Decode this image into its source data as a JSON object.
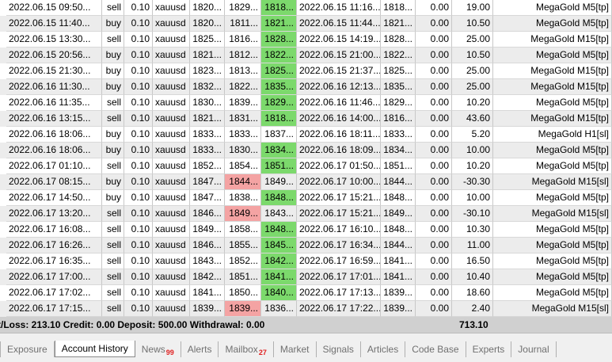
{
  "columns": [
    "open_time",
    "type",
    "volume",
    "symbol",
    "open_price",
    "sl",
    "tp",
    "close_time",
    "close_price",
    "commission",
    "profit",
    "comment"
  ],
  "rows": [
    {
      "open_time": "2022.06.15 09:50...",
      "type": "sell",
      "volume": "0.10",
      "symbol": "xauusd",
      "open_price": "1820...",
      "sl": "1829...",
      "tp": "1818...",
      "close_time": "2022.06.15 11:16...",
      "close_price": "1818...",
      "commission": "0.00",
      "profit": "19.00",
      "comment": "MegaGold M5[tp]",
      "hl": "tp"
    },
    {
      "open_time": "2022.06.15 11:40...",
      "type": "buy",
      "volume": "0.10",
      "symbol": "xauusd",
      "open_price": "1820...",
      "sl": "1811...",
      "tp": "1821...",
      "close_time": "2022.06.15 11:44...",
      "close_price": "1821...",
      "commission": "0.00",
      "profit": "10.50",
      "comment": "MegaGold M5[tp]",
      "hl": "tp"
    },
    {
      "open_time": "2022.06.15 13:30...",
      "type": "sell",
      "volume": "0.10",
      "symbol": "xauusd",
      "open_price": "1825...",
      "sl": "1816...",
      "tp": "1828...",
      "close_time": "2022.06.15 14:19...",
      "close_price": "1828...",
      "commission": "0.00",
      "profit": "25.00",
      "comment": "MegaGold M15[tp]",
      "hl": "tp"
    },
    {
      "open_time": "2022.06.15 20:56...",
      "type": "buy",
      "volume": "0.10",
      "symbol": "xauusd",
      "open_price": "1821...",
      "sl": "1812...",
      "tp": "1822...",
      "close_time": "2022.06.15 21:00...",
      "close_price": "1822...",
      "commission": "0.00",
      "profit": "10.50",
      "comment": "MegaGold M5[tp]",
      "hl": "tp"
    },
    {
      "open_time": "2022.06.15 21:30...",
      "type": "buy",
      "volume": "0.10",
      "symbol": "xauusd",
      "open_price": "1823...",
      "sl": "1813...",
      "tp": "1825...",
      "close_time": "2022.06.15 21:37...",
      "close_price": "1825...",
      "commission": "0.00",
      "profit": "25.00",
      "comment": "MegaGold M15[tp]",
      "hl": "tp"
    },
    {
      "open_time": "2022.06.16 11:30...",
      "type": "buy",
      "volume": "0.10",
      "symbol": "xauusd",
      "open_price": "1832...",
      "sl": "1822...",
      "tp": "1835...",
      "close_time": "2022.06.16 12:13...",
      "close_price": "1835...",
      "commission": "0.00",
      "profit": "25.00",
      "comment": "MegaGold M15[tp]",
      "hl": "tp"
    },
    {
      "open_time": "2022.06.16 11:35...",
      "type": "sell",
      "volume": "0.10",
      "symbol": "xauusd",
      "open_price": "1830...",
      "sl": "1839...",
      "tp": "1829...",
      "close_time": "2022.06.16 11:46...",
      "close_price": "1829...",
      "commission": "0.00",
      "profit": "10.20",
      "comment": "MegaGold M5[tp]",
      "hl": "tp"
    },
    {
      "open_time": "2022.06.16 13:15...",
      "type": "sell",
      "volume": "0.10",
      "symbol": "xauusd",
      "open_price": "1821...",
      "sl": "1831...",
      "tp": "1818...",
      "close_time": "2022.06.16 14:00...",
      "close_price": "1816...",
      "commission": "0.00",
      "profit": "43.60",
      "comment": "MegaGold M15[tp]",
      "hl": "tp"
    },
    {
      "open_time": "2022.06.16 18:06...",
      "type": "buy",
      "volume": "0.10",
      "symbol": "xauusd",
      "open_price": "1833...",
      "sl": "1833...",
      "tp": "1837...",
      "close_time": "2022.06.16 18:11...",
      "close_price": "1833...",
      "commission": "0.00",
      "profit": "5.20",
      "comment": "MegaGold H1[sl]",
      "hl": ""
    },
    {
      "open_time": "2022.06.16 18:06...",
      "type": "buy",
      "volume": "0.10",
      "symbol": "xauusd",
      "open_price": "1833...",
      "sl": "1830...",
      "tp": "1834...",
      "close_time": "2022.06.16 18:09...",
      "close_price": "1834...",
      "commission": "0.00",
      "profit": "10.00",
      "comment": "MegaGold M5[tp]",
      "hl": "tp"
    },
    {
      "open_time": "2022.06.17 01:10...",
      "type": "sell",
      "volume": "0.10",
      "symbol": "xauusd",
      "open_price": "1852...",
      "sl": "1854...",
      "tp": "1851...",
      "close_time": "2022.06.17 01:50...",
      "close_price": "1851...",
      "commission": "0.00",
      "profit": "10.20",
      "comment": "MegaGold M5[tp]",
      "hl": "tp"
    },
    {
      "open_time": "2022.06.17 08:15...",
      "type": "buy",
      "volume": "0.10",
      "symbol": "xauusd",
      "open_price": "1847...",
      "sl": "1844...",
      "tp": "1849...",
      "close_time": "2022.06.17 10:00...",
      "close_price": "1844...",
      "commission": "0.00",
      "profit": "-30.30",
      "comment": "MegaGold M15[sl]",
      "hl": "sl"
    },
    {
      "open_time": "2022.06.17 14:50...",
      "type": "buy",
      "volume": "0.10",
      "symbol": "xauusd",
      "open_price": "1847...",
      "sl": "1838...",
      "tp": "1848...",
      "close_time": "2022.06.17 15:21...",
      "close_price": "1848...",
      "commission": "0.00",
      "profit": "10.00",
      "comment": "MegaGold M5[tp]",
      "hl": "tp"
    },
    {
      "open_time": "2022.06.17 13:20...",
      "type": "sell",
      "volume": "0.10",
      "symbol": "xauusd",
      "open_price": "1846...",
      "sl": "1849...",
      "tp": "1843...",
      "close_time": "2022.06.17 15:21...",
      "close_price": "1849...",
      "commission": "0.00",
      "profit": "-30.10",
      "comment": "MegaGold M15[sl]",
      "hl": "sl"
    },
    {
      "open_time": "2022.06.17 16:08...",
      "type": "sell",
      "volume": "0.10",
      "symbol": "xauusd",
      "open_price": "1849...",
      "sl": "1858...",
      "tp": "1848...",
      "close_time": "2022.06.17 16:10...",
      "close_price": "1848...",
      "commission": "0.00",
      "profit": "10.30",
      "comment": "MegaGold M5[tp]",
      "hl": "tp"
    },
    {
      "open_time": "2022.06.17 16:26...",
      "type": "sell",
      "volume": "0.10",
      "symbol": "xauusd",
      "open_price": "1846...",
      "sl": "1855...",
      "tp": "1845...",
      "close_time": "2022.06.17 16:34...",
      "close_price": "1844...",
      "commission": "0.00",
      "profit": "11.00",
      "comment": "MegaGold M5[tp]",
      "hl": "tp"
    },
    {
      "open_time": "2022.06.17 16:35...",
      "type": "sell",
      "volume": "0.10",
      "symbol": "xauusd",
      "open_price": "1843...",
      "sl": "1852...",
      "tp": "1842...",
      "close_time": "2022.06.17 16:59...",
      "close_price": "1841...",
      "commission": "0.00",
      "profit": "16.50",
      "comment": "MegaGold M5[tp]",
      "hl": "tp"
    },
    {
      "open_time": "2022.06.17 17:00...",
      "type": "sell",
      "volume": "0.10",
      "symbol": "xauusd",
      "open_price": "1842...",
      "sl": "1851...",
      "tp": "1841...",
      "close_time": "2022.06.17 17:01...",
      "close_price": "1841...",
      "commission": "0.00",
      "profit": "10.40",
      "comment": "MegaGold M5[tp]",
      "hl": "tp"
    },
    {
      "open_time": "2022.06.17 17:02...",
      "type": "sell",
      "volume": "0.10",
      "symbol": "xauusd",
      "open_price": "1841...",
      "sl": "1850...",
      "tp": "1840...",
      "close_time": "2022.06.17 17:13...",
      "close_price": "1839...",
      "commission": "0.00",
      "profit": "18.60",
      "comment": "MegaGold M5[tp]",
      "hl": "tp"
    },
    {
      "open_time": "2022.06.17 17:15...",
      "type": "sell",
      "volume": "0.10",
      "symbol": "xauusd",
      "open_price": "1839...",
      "sl": "1839...",
      "tp": "1836...",
      "close_time": "2022.06.17 17:22...",
      "close_price": "1839...",
      "commission": "0.00",
      "profit": "2.40",
      "comment": "MegaGold M15[sl]",
      "hl": "sl"
    }
  ],
  "summary": {
    "text": "t/Loss: 213.10  Credit: 0.00  Deposit: 500.00  Withdrawal: 0.00",
    "total": "713.10"
  },
  "tabs": [
    {
      "label": "Exposure",
      "badge": "",
      "active": false
    },
    {
      "label": "Account History",
      "badge": "",
      "active": true
    },
    {
      "label": "News",
      "badge": "99",
      "active": false
    },
    {
      "label": "Alerts",
      "badge": "",
      "active": false
    },
    {
      "label": "Mailbox",
      "badge": "27",
      "active": false
    },
    {
      "label": "Market",
      "badge": "",
      "active": false
    },
    {
      "label": "Signals",
      "badge": "",
      "active": false
    },
    {
      "label": "Articles",
      "badge": "",
      "active": false
    },
    {
      "label": "Code Base",
      "badge": "",
      "active": false
    },
    {
      "label": "Experts",
      "badge": "",
      "active": false
    },
    {
      "label": "Journal",
      "badge": "",
      "active": false
    }
  ],
  "colors": {
    "tp_highlight": "#7cd96c",
    "sl_highlight": "#f4a3a3",
    "alt_row": "#ececec",
    "badge": "#e02020"
  }
}
